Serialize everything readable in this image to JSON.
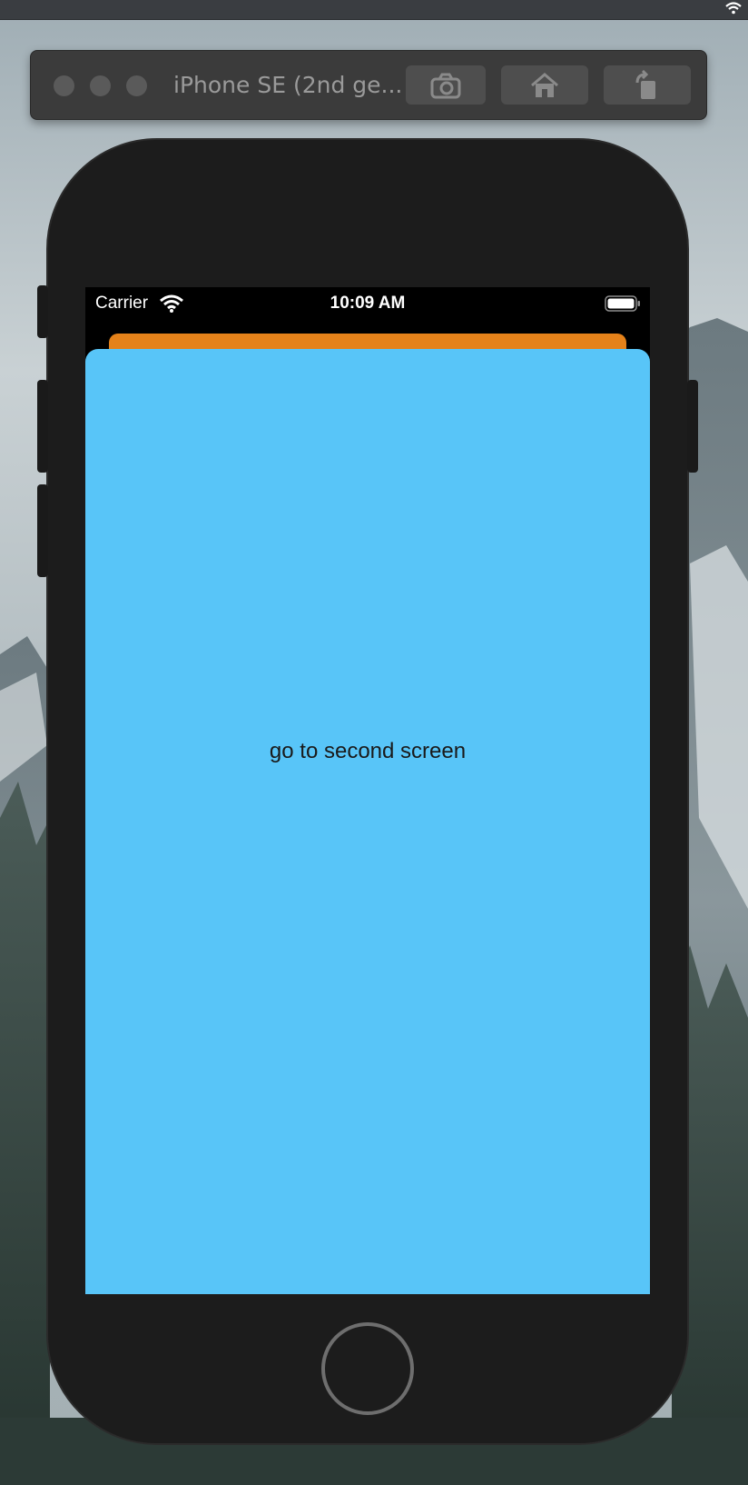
{
  "simulator": {
    "title": "iPhone SE (2nd ge...",
    "buttons": [
      {
        "icon": "camera-icon"
      },
      {
        "icon": "home-icon"
      },
      {
        "icon": "rotate-icon"
      }
    ]
  },
  "status_bar": {
    "carrier": "Carrier",
    "time": "10:09 AM",
    "icons": [
      "wifi-icon",
      "battery-icon"
    ]
  },
  "app": {
    "link_text": "go to second screen",
    "colors": {
      "front_card": "#58c5f8",
      "back_card": "#e5821a"
    }
  }
}
